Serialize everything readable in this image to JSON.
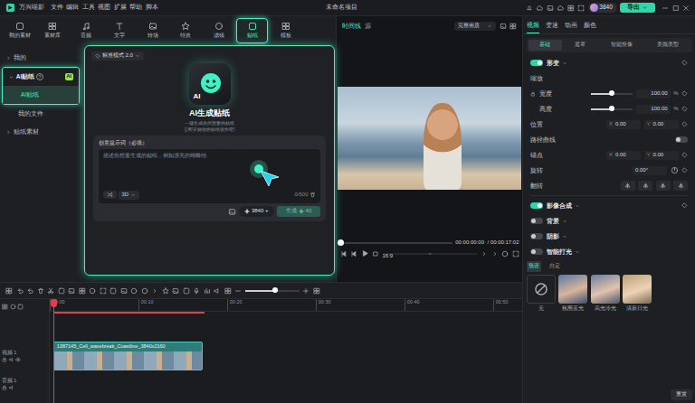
{
  "window": {
    "app": "万兴喵影",
    "menu": [
      "文件",
      "编辑",
      "工具",
      "视图",
      "扩展",
      "帮助",
      "脚本"
    ],
    "project": "未命名项目",
    "credits": "3840",
    "export": "导出"
  },
  "toolbar": [
    {
      "label": "我的素材",
      "selected": false
    },
    {
      "label": "素材库",
      "selected": false
    },
    {
      "label": "音频",
      "selected": false
    },
    {
      "label": "文字",
      "selected": false
    },
    {
      "label": "转场",
      "selected": false
    },
    {
      "label": "特效",
      "selected": false
    },
    {
      "label": "滤镜",
      "selected": false
    },
    {
      "label": "贴纸",
      "selected": true
    },
    {
      "label": "模板",
      "selected": false
    }
  ],
  "sidebar": [
    {
      "label": "我的",
      "expanded": false,
      "selected": false,
      "items": []
    },
    {
      "label": "AI贴纸",
      "expanded": true,
      "selected": true,
      "help": "?",
      "badge": "AI",
      "items": [
        {
          "label": "AI贴纸",
          "selected": true
        },
        {
          "label": "我的文件",
          "selected": false
        }
      ]
    },
    {
      "label": "贴纸素材",
      "expanded": false,
      "selected": false,
      "items": []
    }
  ],
  "popup": {
    "mode": "标准模式 2.0",
    "icon_text": "AI",
    "title": "AI生成贴纸",
    "subtitle": [
      "一键生成你所想要的贴纸",
      "立即开始你的贴纸创作吧!"
    ],
    "prompt_label": "创意提示词（必填）",
    "placeholder": "描述你想要生成的贴纸，例如漂亮的蝴蝶结",
    "style": "3D",
    "count": "0/500",
    "credits": "3840",
    "credits_add": "+",
    "generate": "生成",
    "cost": "40",
    "generate_disabled": true
  },
  "player": {
    "tabs": [
      {
        "label": "时间线",
        "selected": true
      },
      {
        "label": "源",
        "selected": false
      }
    ],
    "quality": "完整画质",
    "current": "00:00:00:00",
    "total": "/ 00:00:17:02",
    "ratio": "16:9",
    "level": 0
  },
  "timeline": {
    "ticks": [
      "00:00",
      "00:10",
      "00:20",
      "00:30",
      "00:40",
      "00:50"
    ],
    "zoom_level": 0.55,
    "playhead": 0,
    "tracks": [
      {
        "kind": "empty",
        "label": ""
      },
      {
        "kind": "video",
        "label": "视频 1",
        "clip": "1387145_Cell_wavebreak_Coastline_3840x2160"
      },
      {
        "kind": "audio",
        "label": "音频 1"
      }
    ]
  },
  "inspector": {
    "tabs": [
      {
        "label": "视频",
        "selected": true
      },
      {
        "label": "变速",
        "selected": false
      },
      {
        "label": "动画",
        "selected": false
      },
      {
        "label": "颜色",
        "selected": false
      }
    ],
    "subtabs": [
      {
        "label": "基础",
        "selected": true
      },
      {
        "label": "遮罩",
        "selected": false
      },
      {
        "label": "智能抠像",
        "selected": false
      },
      {
        "label": "美颜美型",
        "selected": false
      }
    ],
    "transform": {
      "label": "形变",
      "on": true,
      "scale": "缩放",
      "width": {
        "label": "宽度",
        "value": "100.00",
        "unit": "%",
        "level": 0.5
      },
      "height": {
        "label": "高度",
        "value": "100.00",
        "unit": "%",
        "level": 0.5
      },
      "position": {
        "label": "位置",
        "x_label": "X",
        "x": "0.00",
        "y_label": "Y",
        "y": "0.00"
      },
      "path": {
        "label": "路径曲线",
        "on": false
      },
      "anchor": {
        "label": "锚点",
        "x_label": "X",
        "x": "0.00",
        "y_label": "Y",
        "y": "0.00"
      },
      "rotate": {
        "label": "旋转",
        "value": "0.00°"
      },
      "flip": {
        "label": "翻转"
      }
    },
    "sections": [
      {
        "label": "影像合成",
        "on": true
      },
      {
        "label": "背景",
        "on": false
      },
      {
        "label": "阴影",
        "on": false
      },
      {
        "label": "智能打光",
        "on": false
      }
    ],
    "light_tabs": [
      {
        "label": "预设",
        "selected": true
      },
      {
        "label": "自定",
        "selected": false
      }
    ],
    "presets": [
      {
        "label": "无",
        "kind": "none",
        "selected": false
      },
      {
        "label": "氛围蓝光",
        "kind": "photo",
        "selected": false
      },
      {
        "label": "高光冷光",
        "kind": "photo",
        "selected": false
      },
      {
        "label": "清新日光",
        "kind": "photo",
        "selected": false
      }
    ],
    "reset": "重置"
  }
}
